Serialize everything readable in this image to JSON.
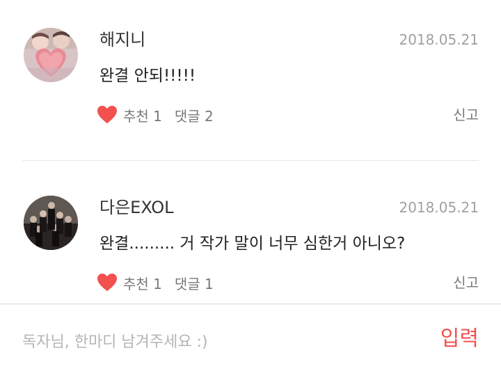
{
  "comments": [
    {
      "nickname": "해지니",
      "date": "2018.05.21",
      "text": "완결 안되!!!!!",
      "like_label": "추천 1",
      "reply_label": "댓글 2",
      "report_label": "신고"
    },
    {
      "nickname": "다은EXOL",
      "date": "2018.05.21",
      "text": "완결......... 거 작가 말이 너무 심한거 아니오?",
      "like_label": "추천 1",
      "reply_label": "댓글 1",
      "report_label": "신고"
    }
  ],
  "input": {
    "placeholder": "독자님, 한마디 남겨주세요 :)",
    "submit_label": "입력"
  },
  "colors": {
    "accent": "#f2514f",
    "heart": "#f2514f",
    "muted": "#a0a0a0",
    "divider": "#e6e6e6"
  },
  "icons": {
    "like": "heart-icon"
  }
}
